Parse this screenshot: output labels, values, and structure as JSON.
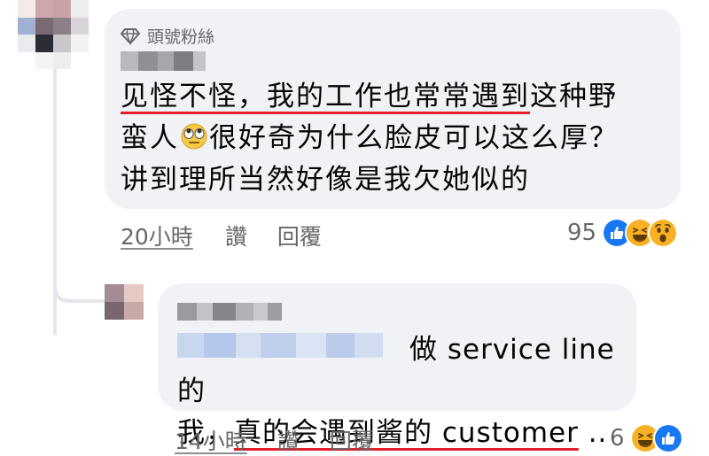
{
  "comment_1": {
    "badge": "頭號粉絲",
    "text_line_1_underlined": "见怪不怪，我的工作也常常遇到",
    "text_line_1_rest": "这种野",
    "text_line_2_start": "蛮人",
    "text_line_2_rest": "很好奇为什么脸皮可以这么厚？",
    "text_line_3": "讲到理所当然好像是我欠她似的",
    "emoji_icon": "face-with-rolling-eyes",
    "time": "20小時",
    "like_label": "讚",
    "reply_label": "回覆",
    "reaction_count": "95",
    "reaction_icons": [
      "like-icon",
      "haha-icon",
      "wow-icon"
    ]
  },
  "comment_2": {
    "text_line_1_rest": "做 service line 的",
    "text_line_2_start": "我，",
    "text_line_2_underlined": "真的会遇到酱的 customer",
    "text_line_2_end": " ..",
    "time": "14小時",
    "like_label": "讚",
    "reply_label": "回覆",
    "reaction_count": "6",
    "reaction_icons": [
      "haha-icon",
      "like-icon"
    ]
  },
  "colors": {
    "bubble_bg": "#f0f2f5",
    "secondary_text": "#65676b",
    "underline_red": "#e41e2a",
    "like_blue": "#1877f2",
    "emoji_yellow": "#f7b125"
  }
}
